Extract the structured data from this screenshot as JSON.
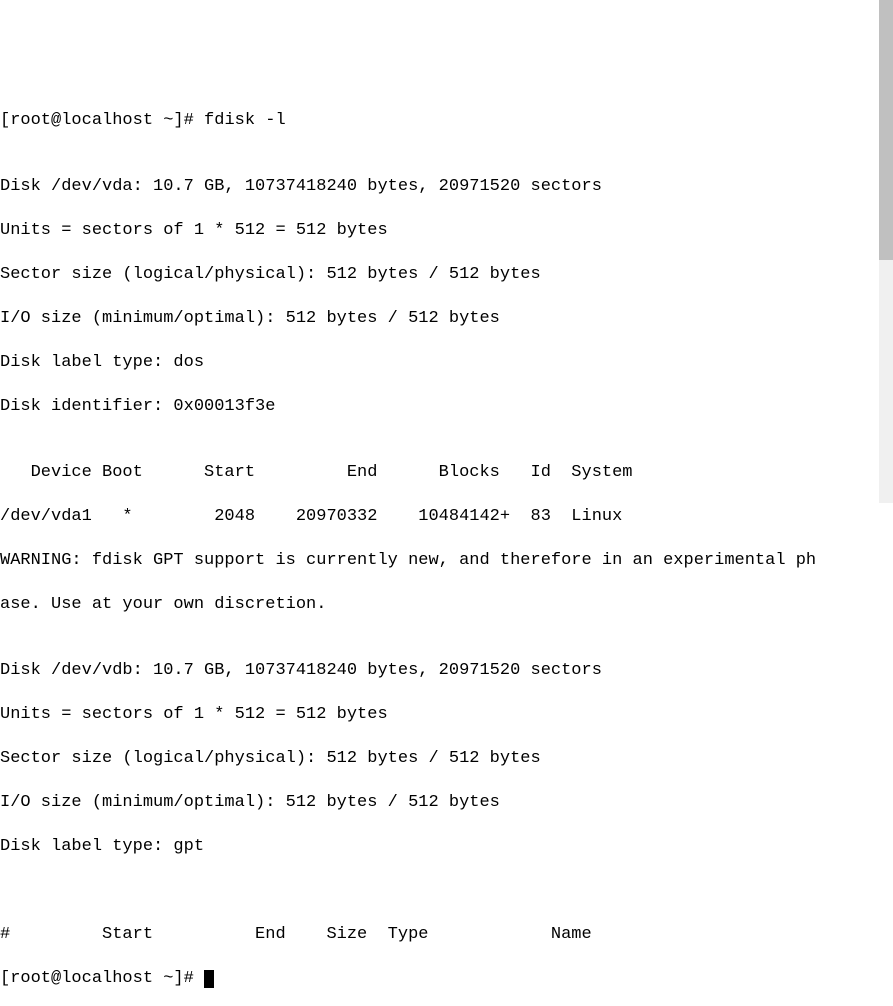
{
  "prompt1": "[root@localhost ~]# ",
  "command1": "fdisk -l",
  "blank": "",
  "vda_header": "Disk /dev/vda: 10.7 GB, 10737418240 bytes, 20971520 sectors",
  "units": "Units = sectors of 1 * 512 = 512 bytes",
  "sector_size": "Sector size (logical/physical): 512 bytes / 512 bytes",
  "io_size": "I/O size (minimum/optimal): 512 bytes / 512 bytes",
  "label_dos": "Disk label type: dos",
  "identifier": "Disk identifier: 0x00013f3e",
  "table_header_vda": "   Device Boot      Start         End      Blocks   Id  System",
  "table_row_vda1": "/dev/vda1   *        2048    20970332    10484142+  83  Linux",
  "warning_l1": "WARNING: fdisk GPT support is currently new, and therefore in an experimental ph",
  "warning_l2": "ase. Use at your own discretion.",
  "vdb_header": "Disk /dev/vdb: 10.7 GB, 10737418240 bytes, 20971520 sectors",
  "label_gpt": "Disk label type: gpt",
  "table_header_vdb": "#         Start          End    Size  Type            Name",
  "prompt2": "[root@localhost ~]# "
}
